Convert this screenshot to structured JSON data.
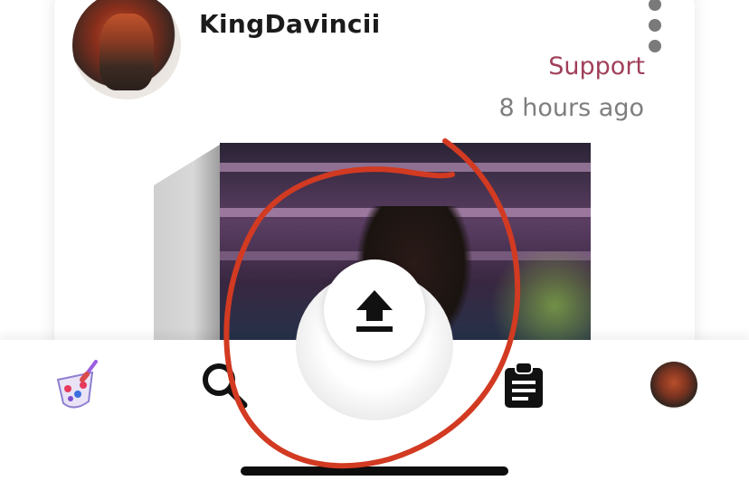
{
  "post": {
    "username": "KingDavincii",
    "support_label": "Support",
    "timestamp": "8 hours ago"
  },
  "icons": {
    "more": "more-vertical-icon",
    "upload": "upload-icon",
    "search": "search-icon",
    "home": "palette-icon",
    "clipboard": "clipboard-icon"
  },
  "colors": {
    "support": "#a0405a",
    "annotation": "#d23a22",
    "text": "#1b1b1b",
    "muted": "#7e7e7e"
  }
}
